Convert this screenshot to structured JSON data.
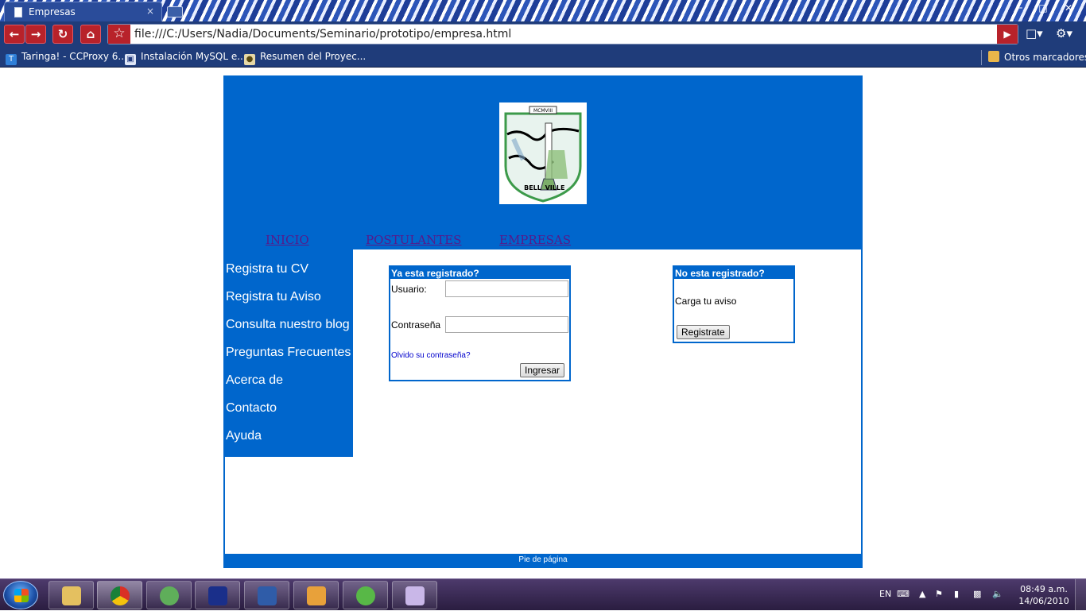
{
  "browser": {
    "tab_title": "Empresas",
    "tab_close": "×",
    "url": "file:///C:/Users/Nadia/Documents/Seminario/prototipo/empresa.html",
    "bookmarks": [
      {
        "label": "Taringa! - CCProxy 6..."
      },
      {
        "label": "Instalación MySQL e..."
      },
      {
        "label": "Resumen del Proyec..."
      }
    ],
    "other_bookmarks": "Otros marcadores"
  },
  "page": {
    "logo": {
      "motto_top": "MCMVIII",
      "text_left": "BELL",
      "text_right": "VILLE"
    },
    "topnav": [
      "INICIO",
      "POSTULANTES",
      "EMPRESAS"
    ],
    "sidebar": [
      "Registra tu CV",
      "Registra tu Aviso",
      "Consulta nuestro blog",
      "Preguntas Frecuentes",
      "Acerca de",
      "Contacto",
      "Ayuda"
    ],
    "login": {
      "title": "Ya esta registrado?",
      "user_label": "Usuario:",
      "user_value": "",
      "pass_label": "Contraseña",
      "pass_value": "",
      "forgot": "Olvido su contraseña?",
      "submit": "Ingresar"
    },
    "register": {
      "title": "No esta registrado?",
      "text": "Carga tu aviso",
      "submit": "Registrate"
    },
    "footer": "Pie de página"
  },
  "taskbar": {
    "lang": "EN",
    "time": "08:49 a.m.",
    "date": "14/06/2010"
  }
}
